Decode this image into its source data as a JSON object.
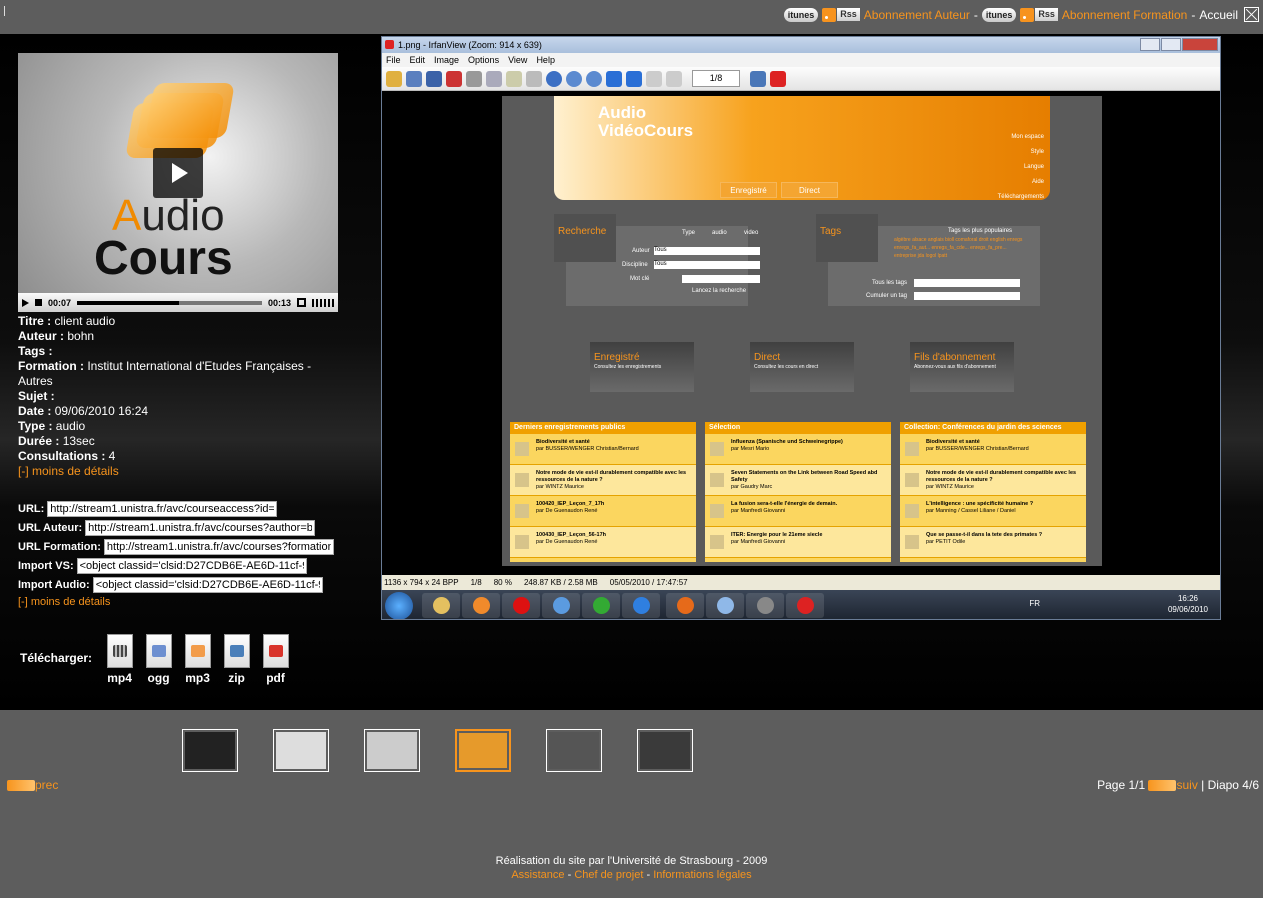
{
  "topnav": {
    "itunes1": "itunes",
    "rss1": "Rss",
    "sub_author": "Abonnement Auteur",
    "itunes2": "itunes",
    "rss2": "Rss",
    "sub_formation": "Abonnement Formation",
    "home": "Accueil",
    "sep": "-"
  },
  "player": {
    "logo_line1_a": "A",
    "logo_line1_b": "udio",
    "logo_line2": "Cours",
    "time_current": "00:07",
    "time_total": "00:13",
    "progress": 0.55
  },
  "meta": [
    {
      "label": "Titre :",
      "value": "client audio"
    },
    {
      "label": "Auteur :",
      "value": "bohn"
    },
    {
      "label": "Tags :",
      "value": ""
    },
    {
      "label": "Formation :",
      "value": "Institut International d'Etudes Françaises - Autres"
    },
    {
      "label": "Sujet :",
      "value": ""
    },
    {
      "label": "Date :",
      "value": "09/06/2010 16:24"
    },
    {
      "label": "Type :",
      "value": "audio"
    },
    {
      "label": "Durée :",
      "value": "13sec"
    },
    {
      "label": "Consultations :",
      "value": "4"
    }
  ],
  "less_details": "[-] moins de détails",
  "urls": {
    "url_label": "URL:",
    "url_value": "http://stream1.unistra.fr/avc/courseaccess?id=",
    "author_label": "URL Auteur:",
    "author_value": "http://stream1.unistra.fr/avc/courses?author=b",
    "formation_label": "URL Formation:",
    "formation_value": "http://stream1.unistra.fr/avc/courses?formation",
    "vs_label": "Import VS:",
    "vs_value": "<object classid='clsid:D27CDB6E-AE6D-11cf-9",
    "audio_label": "Import Audio:",
    "audio_value": "<object classid='clsid:D27CDB6E-AE6D-11cf-9",
    "less_details": "[-] moins de détails"
  },
  "download": {
    "label": "Télécharger:",
    "formats": [
      "mp4",
      "ogg",
      "mp3",
      "zip",
      "pdf"
    ]
  },
  "screenshot": {
    "title": "1.png - IrfanView (Zoom: 914 x 639)",
    "menu": [
      "File",
      "Edit",
      "Image",
      "Options",
      "View",
      "Help"
    ],
    "page": "1/8",
    "status": [
      "1136 x 794 x 24 BPP",
      "1/8",
      "80 %",
      "248.87 KB / 2.58 MB",
      "05/05/2010 / 17:47:57"
    ],
    "lang": "FR",
    "clock_time": "16:26",
    "clock_date": "09/06/2010",
    "site": {
      "title_line1": "Audio",
      "title_line2": "VidéoCours",
      "nav": [
        "Mon espace",
        "Style",
        "Langue",
        "Aide",
        "Téléchargements"
      ],
      "tabs": [
        "Enregistré",
        "Direct"
      ],
      "search": {
        "head": "Recherche",
        "type": "Type",
        "audio": "audio",
        "video": "video",
        "author": "Auteur",
        "discipline": "Discipline",
        "keyword": "Mot clé",
        "all": "Tous",
        "launch": "Lancez la recherche"
      },
      "tags": {
        "head": "Tags",
        "popular": "Tags les plus populaires",
        "cloud": "algèbre alsace anglais bioll comaforal droit english enregs enregs_fa_aut... enregs_fa_cde... enregs_fa_pre... entreprise jda logol lpatt",
        "all_tags": "Tous les tags",
        "cumulate": "Cumuler un tag"
      },
      "tiles": [
        {
          "title": "Enregistré",
          "sub": "Consultez les enregistrements"
        },
        {
          "title": "Direct",
          "sub": "Consultez les cours en direct"
        },
        {
          "title": "Fils d'abonnement",
          "sub": "Abonnez-vous aux fils d'abonnement"
        }
      ],
      "columns": [
        {
          "head": "Derniers enregistrements publics",
          "items": [
            {
              "t": "Biodiversité et santé",
              "a": "par BUSSER/WENGER Christian/Bernard"
            },
            {
              "t": "Notre mode de vie est-il durablement compatible avec les ressources de la nature ?",
              "a": "par WINTZ Maurice"
            },
            {
              "t": "100420_IEP_Leçon_7_17h",
              "a": "par De Guenaudon René"
            },
            {
              "t": "100430_IEP_Leçon_56-17h",
              "a": "par De Guenaudon René"
            }
          ]
        },
        {
          "head": "Sélection",
          "items": [
            {
              "t": "Influenza (Spanische und Schweinegrippe)",
              "a": "par Mesri Mario"
            },
            {
              "t": "Seven Statements on the Link between Road Speed abd Safety",
              "a": "par Gaudry Marc"
            },
            {
              "t": "La fusion sera-t-elle l'énergie de demain.",
              "a": "par Manfredi Giovanni"
            },
            {
              "t": "ITER: Energie pour le 21eme siecle",
              "a": "par Manfredi Giovanni"
            }
          ]
        },
        {
          "head": "Collection: Conférences du jardin des sciences",
          "items": [
            {
              "t": "Biodiversité et santé",
              "a": "par BUSSER/WENGER Christian/Bernard"
            },
            {
              "t": "Notre mode de vie est-il durablement compatible avec les ressources de la nature ?",
              "a": "par WINTZ Maurice"
            },
            {
              "t": "L'intelligence : une spécificité humaine ?",
              "a": "par Manning / Cassel Liliane / Daniel"
            },
            {
              "t": "Que se passe-t-il dans la tete des primates ?",
              "a": "par PETIT Odile"
            }
          ]
        }
      ]
    }
  },
  "thumbs": [
    {
      "label": "diapo-1",
      "selected": false,
      "color": "#222222"
    },
    {
      "label": "diapo-2",
      "selected": false,
      "color": "#dddddd"
    },
    {
      "label": "diapo-3",
      "selected": false,
      "color": "#cccccc"
    },
    {
      "label": "diapo-4",
      "selected": true,
      "color": "#e69a2b"
    },
    {
      "label": "diapo-5",
      "selected": false,
      "color": "#555555"
    },
    {
      "label": "diapo-6",
      "selected": false,
      "color": "#3a3a3a"
    }
  ],
  "pager": {
    "prev": "prec",
    "page": "Page 1/1",
    "next": "suiv",
    "diapo": "| Diapo 4/6"
  },
  "footer": {
    "credit": "Réalisation du site par l'Université de Strasbourg - 2009",
    "links": [
      "Assistance",
      "Chef de projet",
      "Informations légales"
    ],
    "sep": " - "
  },
  "colors": {
    "accent": "#f7941d",
    "bg": "#5d5d5d"
  }
}
